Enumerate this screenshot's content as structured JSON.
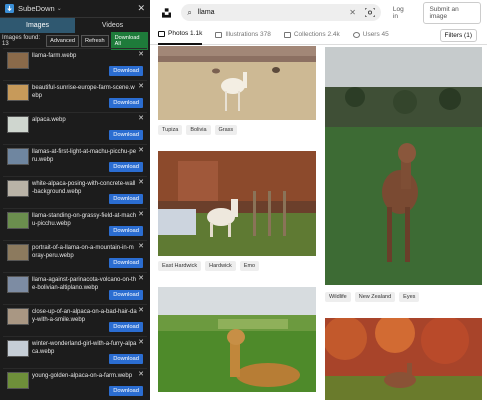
{
  "extension": {
    "title": "SubeDown",
    "tabs": [
      "Images",
      "Videos"
    ],
    "images_found": "Images found: 13",
    "buttons": {
      "advanced": "Advanced",
      "refresh": "Refresh",
      "download_all": "Download All"
    },
    "download_label": "Download",
    "close_glyph": "✕",
    "items": [
      {
        "name": "llama-farm.webp",
        "thumb": "#8a6a4a"
      },
      {
        "name": "beautiful-sunrise-europe-farm-scene.webp",
        "thumb": "#c79a5a"
      },
      {
        "name": "alpaca.webp",
        "thumb": "#cfd6cf"
      },
      {
        "name": "llamas-at-first-light-at-machu-picchu-peru.webp",
        "thumb": "#6f86a0"
      },
      {
        "name": "white-alpaca-posing-with-concrete-wall-background.webp",
        "thumb": "#b9b3a7"
      },
      {
        "name": "llama-standing-on-grassy-field-at-machu-picchu.webp",
        "thumb": "#6b8e4e"
      },
      {
        "name": "portrait-of-a-llama-on-a-mountain-in-moray-peru.webp",
        "thumb": "#8c7a5e"
      },
      {
        "name": "llama-against-parinacota-volcano-on-the-bolivian-altiplano.webp",
        "thumb": "#7d8ca3"
      },
      {
        "name": "close-up-of-an-alpaca-on-a-bad-hair-day-with-a-smile.webp",
        "thumb": "#a99783"
      },
      {
        "name": "winter-wonderland-girl-with-a-furry-alpaca.webp",
        "thumb": "#c6ced6"
      },
      {
        "name": "young-golden-alpaca-on-a-farm.webp",
        "thumb": "#6e8f3a"
      }
    ]
  },
  "page": {
    "search": {
      "value": "llama"
    },
    "header": {
      "login": "Log in",
      "submit": "Submit an image"
    },
    "tabs": [
      {
        "label": "Photos 1.1k",
        "active": true
      },
      {
        "label": "Illustrations 378",
        "active": false
      },
      {
        "label": "Collections 2.4k",
        "active": false
      },
      {
        "label": "Users 45",
        "active": false
      }
    ],
    "filters": "Filters (1)",
    "photo_tags": {
      "p1": [
        "Tupiza",
        "Bolivia",
        "Grass"
      ],
      "p2": [
        "East Hardwick",
        "Hardwick",
        "Emo"
      ],
      "p3": [
        "Wildlife",
        "New Zealand",
        "Eyes"
      ]
    }
  }
}
